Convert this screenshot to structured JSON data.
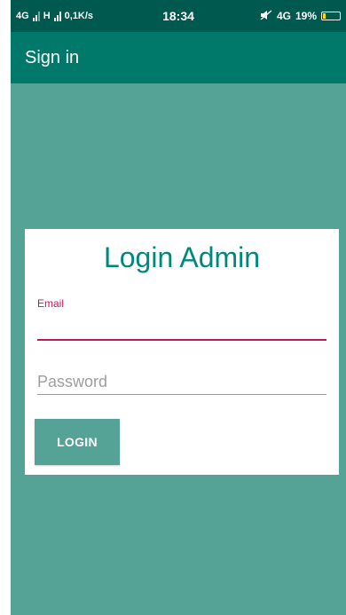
{
  "status_bar": {
    "network_left": "4G",
    "network_mid": "H",
    "speed": "0,1K/s",
    "time": "18:34",
    "network_right": "4G",
    "battery_percent": "19%",
    "battery_level": 0.19,
    "icons": [
      "signal-4g-icon",
      "signal-h-icon",
      "mute-icon",
      "signal-4g-right-icon",
      "battery-icon"
    ]
  },
  "appbar": {
    "title": "Sign in"
  },
  "login_card": {
    "title": "Login Admin",
    "email": {
      "label": "Email",
      "value": ""
    },
    "password": {
      "placeholder": "Password",
      "value": ""
    },
    "login_button_label": "LOGIN"
  },
  "colors": {
    "status_bar": "#00594f",
    "appbar": "#00796b",
    "background": "#55a297",
    "accent": "#c2185b",
    "title_text": "#00897b",
    "button": "#55a297"
  }
}
